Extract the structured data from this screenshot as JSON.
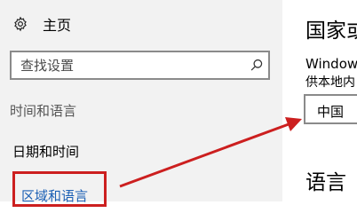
{
  "sidebar": {
    "home_label": "主页",
    "search_placeholder": "查找设置",
    "section_title": "时间和语言",
    "items": [
      {
        "label": "日期和时间"
      },
      {
        "label": "区域和语言"
      }
    ]
  },
  "main": {
    "heading": "国家或",
    "windows_text": "Window",
    "provide_text": "供本地内",
    "country_value": "中国",
    "language_heading": "语言"
  },
  "colors": {
    "highlight_box": "#cc1f1f",
    "arrow": "#cc1f1f",
    "active_nav": "#1a5fb4"
  },
  "icons": [
    "gear-icon",
    "search-icon",
    "red-arrow-annotation"
  ]
}
